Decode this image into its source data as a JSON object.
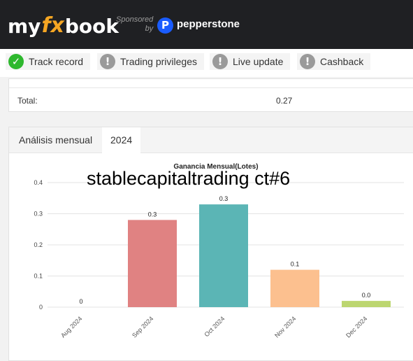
{
  "header": {
    "logo_left": "my",
    "logo_fx": "fx",
    "logo_right": "book",
    "sponsored_line1": "Sponsored",
    "sponsored_line2": "by",
    "sponsor_icon": "P",
    "sponsor_name": "pepperstone"
  },
  "badges": [
    {
      "label": "Track record",
      "icon": "check-icon",
      "status": "verified",
      "color": "#2eb82e"
    },
    {
      "label": "Trading privileges",
      "icon": "exclamation-icon",
      "status": "unverified",
      "color": "#9a9a9a"
    },
    {
      "label": "Live update",
      "icon": "exclamation-icon",
      "status": "unverified",
      "color": "#9a9a9a"
    },
    {
      "label": "Cashback",
      "icon": "exclamation-icon",
      "status": "unverified",
      "color": "#9a9a9a"
    }
  ],
  "summary": {
    "total_label": "Total:",
    "total_value": "0.27"
  },
  "monthly": {
    "tabs": [
      "Análisis mensual",
      "2024"
    ],
    "active_tab": "2024"
  },
  "overlay_text": "stablecapitaltrading ct#6",
  "chart_data": {
    "type": "bar",
    "title": "Ganancia Mensual(Lotes)",
    "categories": [
      "Aug 2024",
      "Sep 2024",
      "Oct 2024",
      "Nov 2024",
      "Dec 2024"
    ],
    "values": [
      0,
      0.28,
      0.33,
      0.12,
      0.02
    ],
    "data_labels": [
      "0",
      "0.3",
      "0.3",
      "0.1",
      "0.0"
    ],
    "colors": [
      "#f4a7a7",
      "#e08282",
      "#5bb5b5",
      "#fcc08f",
      "#bcd670"
    ],
    "yticks": [
      "0",
      "0.1",
      "0.2",
      "0.3",
      "0.4"
    ],
    "ylim": [
      0,
      0.4
    ],
    "grid": true
  }
}
